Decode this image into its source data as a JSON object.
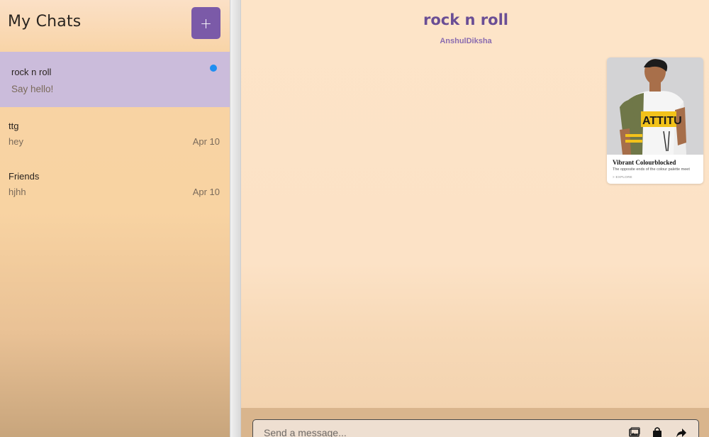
{
  "sidebar": {
    "title": "My Chats",
    "new_chat_label": "+",
    "chats": [
      {
        "name": "rock n roll",
        "last_message": "Say hello!",
        "date": "",
        "unread": true
      },
      {
        "name": "ttg",
        "last_message": "hey",
        "date": "Apr 10",
        "unread": false
      },
      {
        "name": "Friends",
        "last_message": "hjhh",
        "date": "Apr 10",
        "unread": false
      }
    ]
  },
  "room": {
    "title": "rock n roll",
    "members": "AnshulDiksha"
  },
  "product_card": {
    "image_icon": "product-photo",
    "image_text": "ATTITU",
    "title": "Vibrant Colourblocked",
    "subtitle": "The opposite ends of the colour palette meet",
    "link": "> EXPLORE"
  },
  "composer": {
    "placeholder": "Send a message...",
    "icons": [
      "image-icon",
      "shopping-bag-icon",
      "share-icon"
    ]
  },
  "colors": {
    "accent": "#7b5aa8",
    "active_chat": "#cbbcdb",
    "unread_dot": "#1f8ef1",
    "title": "#6a4e95"
  }
}
